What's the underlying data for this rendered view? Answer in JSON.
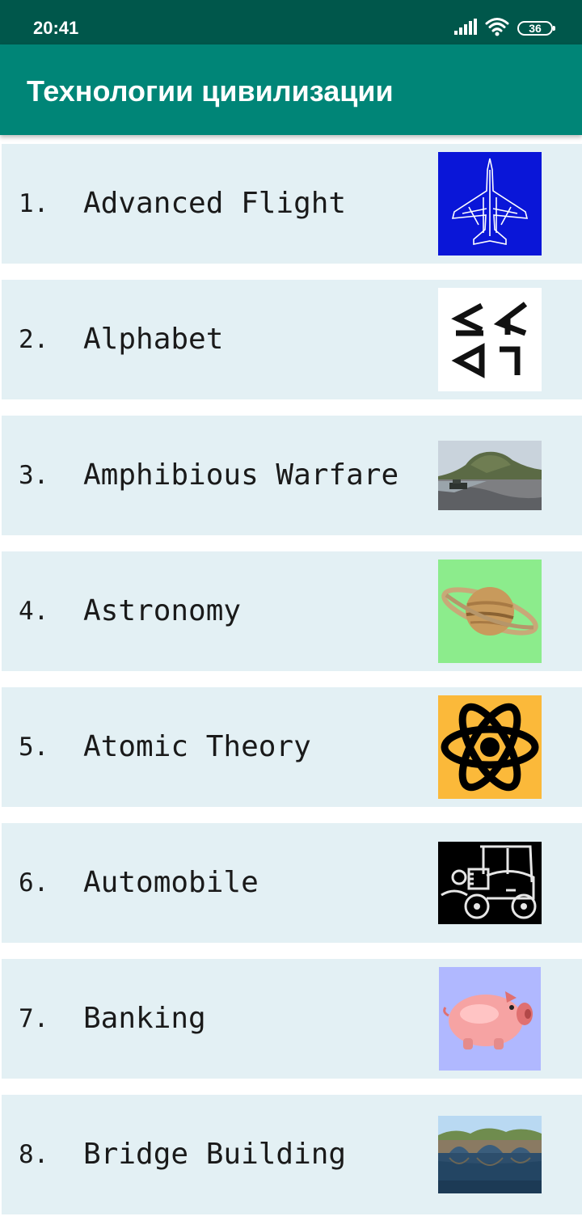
{
  "status_bar": {
    "time": "20:41",
    "battery": "36",
    "icons": [
      "signal-icon",
      "wifi-icon",
      "battery-icon"
    ]
  },
  "app_bar": {
    "title": "Технологии цивилизации",
    "color": "#008577"
  },
  "list": {
    "items": [
      {
        "index": "1.",
        "name": "Advanced Flight",
        "image": "jet-fighter-image"
      },
      {
        "index": "2.",
        "name": "Alphabet",
        "image": "alphabet-glyphs-image"
      },
      {
        "index": "3.",
        "name": "Amphibious Warfare",
        "image": "beach-landing-photo"
      },
      {
        "index": "4.",
        "name": "Astronomy",
        "image": "saturn-image"
      },
      {
        "index": "5.",
        "name": "Atomic Theory",
        "image": "atom-image"
      },
      {
        "index": "6.",
        "name": "Automobile",
        "image": "vintage-car-image"
      },
      {
        "index": "7.",
        "name": "Banking",
        "image": "piggy-bank-image"
      },
      {
        "index": "8.",
        "name": "Bridge Building",
        "image": "stone-bridge-photo"
      }
    ]
  }
}
